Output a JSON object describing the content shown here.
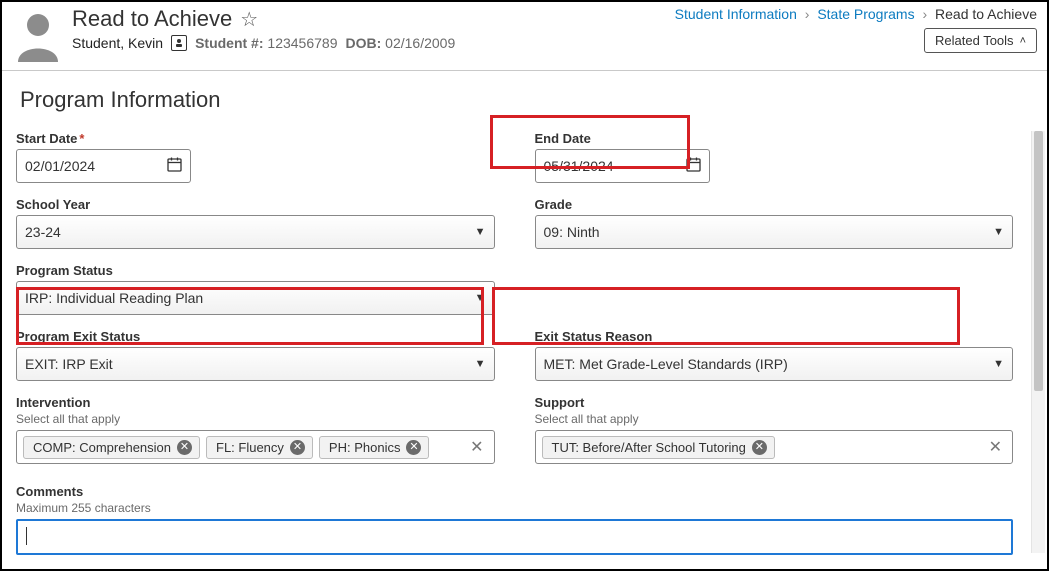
{
  "header": {
    "title": "Read to Achieve",
    "student_name": "Student, Kevin",
    "student_num_label": "Student #:",
    "student_num": "123456789",
    "dob_label": "DOB:",
    "dob": "02/16/2009",
    "related_tools": "Related Tools"
  },
  "breadcrumbs": {
    "items": [
      "Student Information",
      "State Programs",
      "Read to Achieve"
    ]
  },
  "section": {
    "title": "Program Information"
  },
  "start_date": {
    "label": "Start Date",
    "value": "02/01/2024"
  },
  "end_date": {
    "label": "End Date",
    "value": "05/31/2024"
  },
  "school_year": {
    "label": "School Year",
    "value": "23-24"
  },
  "grade": {
    "label": "Grade",
    "value": "09: Ninth"
  },
  "program_status": {
    "label": "Program Status",
    "value": "IRP: Individual Reading Plan"
  },
  "exit_status": {
    "label": "Program Exit Status",
    "value": "EXIT: IRP Exit"
  },
  "exit_reason": {
    "label": "Exit Status Reason",
    "value": "MET: Met Grade-Level Standards (IRP)"
  },
  "intervention": {
    "label": "Intervention",
    "sublabel": "Select all that apply",
    "chips": [
      "COMP: Comprehension",
      "FL: Fluency",
      "PH: Phonics"
    ]
  },
  "support": {
    "label": "Support",
    "sublabel": "Select all that apply",
    "chips": [
      "TUT: Before/After School Tutoring"
    ]
  },
  "comments": {
    "label": "Comments",
    "sublabel": "Maximum 255 characters",
    "value": ""
  }
}
